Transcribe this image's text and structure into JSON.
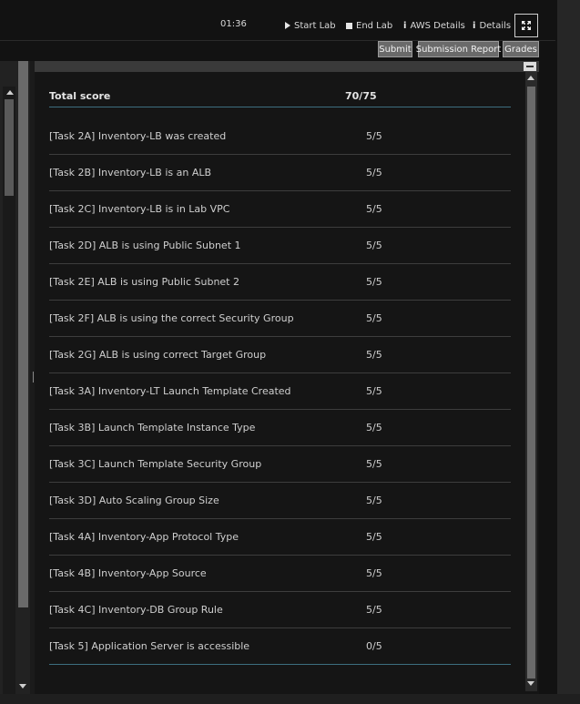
{
  "toolbar": {
    "timer": "01:36",
    "start_lab": "Start Lab",
    "end_lab": "End Lab",
    "aws_details": "AWS Details",
    "details": "Details"
  },
  "actions": {
    "submit": "Submit",
    "submission_report": "Submission Report",
    "grades": "Grades"
  },
  "grades": {
    "header": {
      "label": "Total score",
      "score": "70/75"
    },
    "rows": [
      {
        "label": "[Task 2A] Inventory-LB was created",
        "score": "5/5"
      },
      {
        "label": "[Task 2B] Inventory-LB is an ALB",
        "score": "5/5"
      },
      {
        "label": "[Task 2C] Inventory-LB is in Lab VPC",
        "score": "5/5"
      },
      {
        "label": "[Task 2D] ALB is using Public Subnet 1",
        "score": "5/5"
      },
      {
        "label": "[Task 2E] ALB is using Public Subnet 2",
        "score": "5/5"
      },
      {
        "label": "[Task 2F] ALB is using the correct Security Group",
        "score": "5/5"
      },
      {
        "label": "[Task 2G] ALB is using correct Target Group",
        "score": "5/5"
      },
      {
        "label": "[Task 3A] Inventory-LT Launch Template Created",
        "score": "5/5"
      },
      {
        "label": "[Task 3B] Launch Template Instance Type",
        "score": "5/5"
      },
      {
        "label": "[Task 3C] Launch Template Security Group",
        "score": "5/5"
      },
      {
        "label": "[Task 3D] Auto Scaling Group Size",
        "score": "5/5"
      },
      {
        "label": "[Task 4A] Inventory-App Protocol Type",
        "score": "5/5"
      },
      {
        "label": "[Task 4B] Inventory-App Source",
        "score": "5/5"
      },
      {
        "label": "[Task 4C] Inventory-DB Group Rule",
        "score": "5/5"
      },
      {
        "label": "[Task 5] Application Server is accessible",
        "score": "0/5"
      }
    ]
  }
}
